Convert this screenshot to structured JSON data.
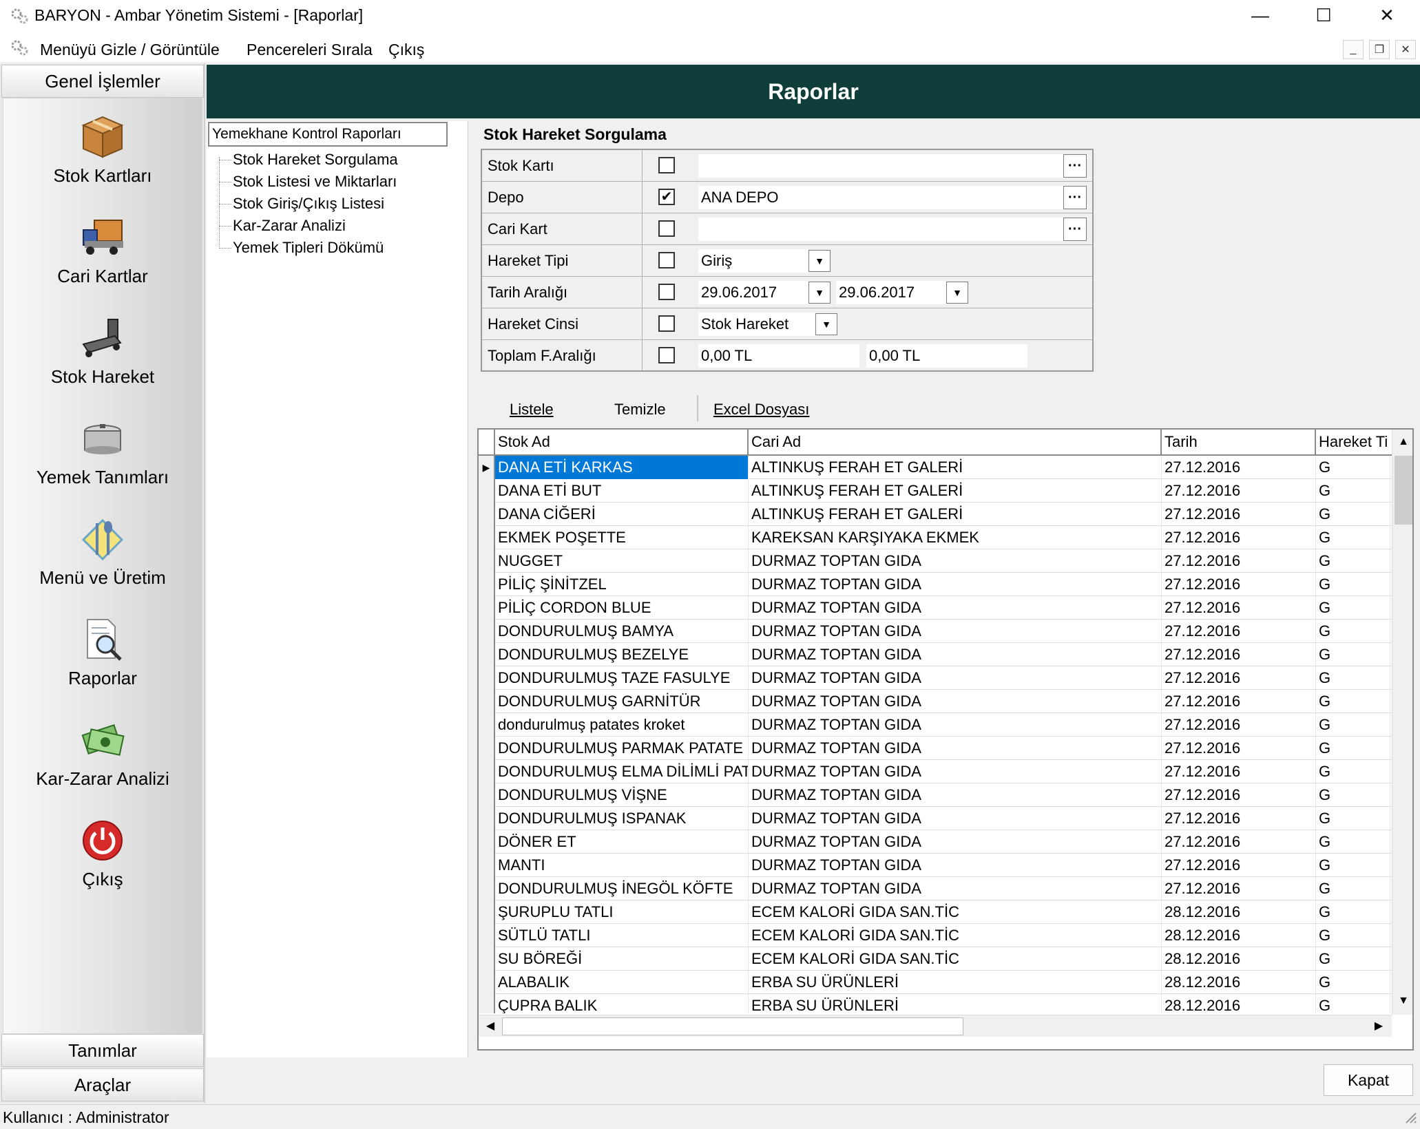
{
  "window": {
    "title": "BARYON - Ambar Yönetim Sistemi - [Raporlar]",
    "minimize": "—",
    "maximize": "☐",
    "close": "✕"
  },
  "menubar": {
    "items": [
      "Menüyü Gizle / Görüntüle",
      "Pencereleri Sırala",
      "Çıkış"
    ],
    "mdi_min": "_",
    "mdi_restore": "❐",
    "mdi_close": "✕"
  },
  "sidebar": {
    "header": "Genel İşlemler",
    "items": [
      {
        "label": "Stok Kartları",
        "icon": "box-icon"
      },
      {
        "label": "Cari Kartlar",
        "icon": "truck-icon"
      },
      {
        "label": "Stok Hareket",
        "icon": "hand-truck-icon"
      },
      {
        "label": "Yemek Tanımları",
        "icon": "pot-icon"
      },
      {
        "label": "Menü ve Üretim",
        "icon": "cutlery-icon"
      },
      {
        "label": "Raporlar",
        "icon": "report-magnifier-icon"
      },
      {
        "label": "Kar-Zarar Analizi",
        "icon": "money-icon"
      },
      {
        "label": "Çıkış",
        "icon": "power-icon"
      }
    ],
    "footer": [
      "Tanımlar",
      "Araçlar"
    ]
  },
  "page": {
    "header": "Raporlar"
  },
  "tree": {
    "root": "Yemekhane Kontrol Raporları",
    "children": [
      "Stok Hareket Sorgulama",
      "Stok Listesi ve Miktarları",
      "Stok Giriş/Çıkış Listesi",
      "Kar-Zarar Analizi",
      "Yemek Tipleri Dökümü"
    ]
  },
  "query": {
    "title": "Stok Hareket Sorgulama",
    "rows": [
      {
        "label": "Stok Kartı",
        "checked": false,
        "value": ""
      },
      {
        "label": "Depo",
        "checked": true,
        "value": "ANA DEPO"
      },
      {
        "label": "Cari Kart",
        "checked": false,
        "value": ""
      },
      {
        "label": "Hareket Tipi",
        "checked": false,
        "value": "Giriş"
      },
      {
        "label": "Tarih Aralığı",
        "checked": false,
        "value": "29.06.2017",
        "value2": "29.06.2017"
      },
      {
        "label": "Hareket Cinsi",
        "checked": false,
        "value": "Stok Hareket"
      },
      {
        "label": "Toplam F.Aralığı",
        "checked": false,
        "value": "0,00 TL",
        "value2": "0,00 TL"
      }
    ],
    "ellipsis": "···",
    "checkmark": "✔"
  },
  "toolbar": {
    "list": "Listele",
    "clear": "Temizle",
    "excel": "Excel Dosyası"
  },
  "grid": {
    "columns": [
      "Stok Ad",
      "Cari Ad",
      "Tarih",
      "Hareket Ti"
    ],
    "rows": [
      [
        "DANA ETİ KARKAS",
        "ALTINKUŞ FERAH ET GALERİ",
        "27.12.2016",
        "G"
      ],
      [
        "DANA ETİ BUT",
        "ALTINKUŞ FERAH ET GALERİ",
        "27.12.2016",
        "G"
      ],
      [
        "DANA CİĞERİ",
        "ALTINKUŞ FERAH ET GALERİ",
        "27.12.2016",
        "G"
      ],
      [
        "EKMEK POŞETTE",
        "KAREKSAN KARŞIYAKA EKMEK",
        "27.12.2016",
        "G"
      ],
      [
        "NUGGET",
        "DURMAZ TOPTAN GIDA",
        "27.12.2016",
        "G"
      ],
      [
        "PİLİÇ ŞİNİTZEL",
        "DURMAZ TOPTAN GIDA",
        "27.12.2016",
        "G"
      ],
      [
        "PİLİÇ  CORDON BLUE",
        "DURMAZ TOPTAN GIDA",
        "27.12.2016",
        "G"
      ],
      [
        "DONDURULMUŞ BAMYA",
        "DURMAZ TOPTAN GIDA",
        "27.12.2016",
        "G"
      ],
      [
        "DONDURULMUŞ BEZELYE",
        "DURMAZ TOPTAN GIDA",
        "27.12.2016",
        "G"
      ],
      [
        "DONDURULMUŞ TAZE FASULYE",
        "DURMAZ TOPTAN GIDA",
        "27.12.2016",
        "G"
      ],
      [
        "DONDURULMUŞ GARNİTÜR",
        "DURMAZ TOPTAN GIDA",
        "27.12.2016",
        "G"
      ],
      [
        "dondurulmuş patates kroket",
        "DURMAZ TOPTAN GIDA",
        "27.12.2016",
        "G"
      ],
      [
        "DONDURULMUŞ PARMAK PATATE",
        "DURMAZ TOPTAN GIDA",
        "27.12.2016",
        "G"
      ],
      [
        "DONDURULMUŞ ELMA DİLİMLİ PAT",
        "DURMAZ TOPTAN GIDA",
        "27.12.2016",
        "G"
      ],
      [
        "DONDURULMUŞ VİŞNE",
        "DURMAZ TOPTAN GIDA",
        "27.12.2016",
        "G"
      ],
      [
        "DONDURULMUŞ ISPANAK",
        "DURMAZ TOPTAN GIDA",
        "27.12.2016",
        "G"
      ],
      [
        "DÖNER ET",
        "DURMAZ TOPTAN GIDA",
        "27.12.2016",
        "G"
      ],
      [
        "MANTI",
        "DURMAZ TOPTAN GIDA",
        "27.12.2016",
        "G"
      ],
      [
        "DONDURULMUŞ İNEGÖL KÖFTE",
        "DURMAZ TOPTAN GIDA",
        "27.12.2016",
        "G"
      ],
      [
        "ŞURUPLU TATLI",
        "ECEM KALORİ GIDA SAN.TİC",
        "28.12.2016",
        "G"
      ],
      [
        "SÜTLÜ TATLI",
        "ECEM KALORİ GIDA SAN.TİC",
        "28.12.2016",
        "G"
      ],
      [
        "SU BÖREĞİ",
        "ECEM KALORİ GIDA SAN.TİC",
        "28.12.2016",
        "G"
      ],
      [
        "ALABALIK",
        "ERBA SU ÜRÜNLERİ",
        "28.12.2016",
        "G"
      ],
      [
        "ÇUPRA BALIK",
        "ERBA SU ÜRÜNLERİ",
        "28.12.2016",
        "G"
      ]
    ],
    "selected_row": 0,
    "row_pointer": "▶"
  },
  "actions": {
    "close": "Kapat"
  },
  "status": {
    "user": "Kullanıcı  : Administrator"
  },
  "colors": {
    "header_bg": "#0f3e3a",
    "selection": "#0078d7"
  }
}
